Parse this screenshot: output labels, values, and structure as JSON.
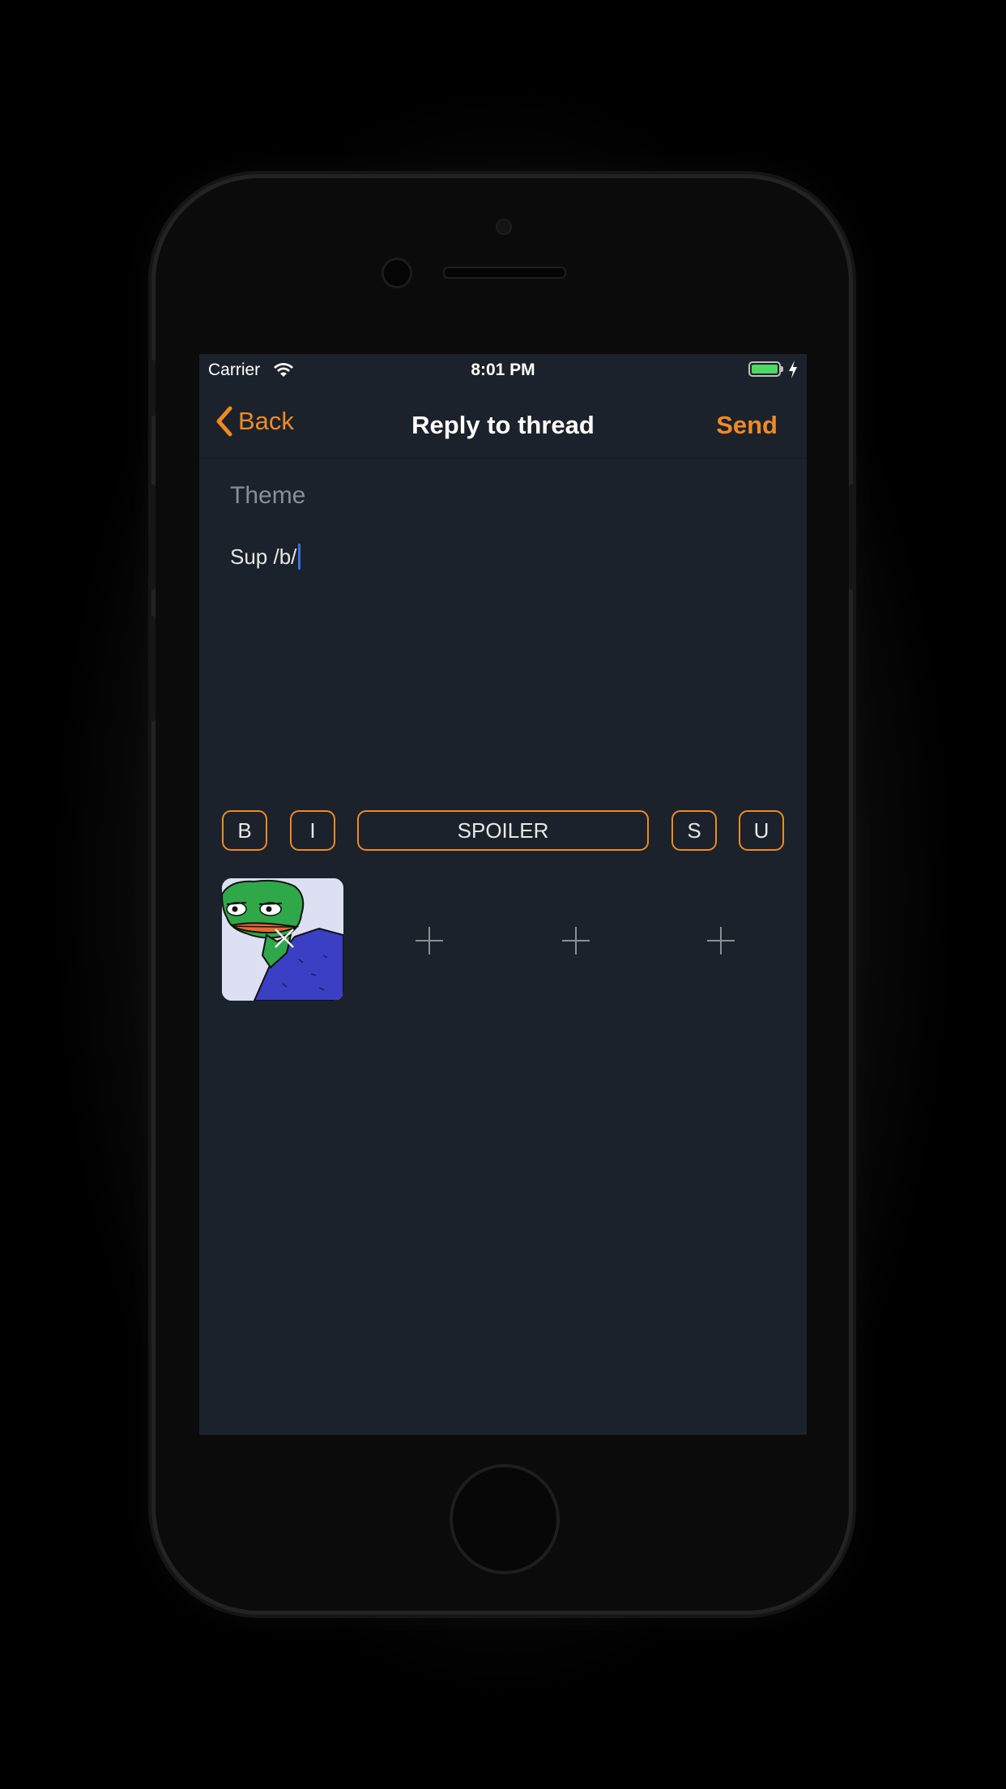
{
  "status_bar": {
    "carrier": "Carrier",
    "time": "8:01 PM",
    "wifi_icon": "wifi-icon",
    "battery_icon": "battery-icon",
    "charging_icon": "bolt-icon"
  },
  "nav": {
    "back_label": "Back",
    "title": "Reply to thread",
    "send_label": "Send"
  },
  "compose": {
    "theme_placeholder": "Theme",
    "theme_value": "",
    "body_text": "Sup /b/"
  },
  "format_buttons": {
    "bold": "B",
    "italic": "I",
    "spoiler": "SPOILER",
    "strike": "S",
    "underline": "U"
  },
  "attachments": {
    "slots": [
      {
        "type": "image",
        "icon": "frog-image",
        "remove_icon": "close-icon"
      },
      {
        "type": "add",
        "icon": "plus-icon"
      },
      {
        "type": "add",
        "icon": "plus-icon"
      },
      {
        "type": "add",
        "icon": "plus-icon"
      }
    ]
  },
  "colors": {
    "accent": "#f08a24",
    "background": "#1b222b",
    "text": "#e8e8e8",
    "placeholder": "#8a8f96"
  }
}
